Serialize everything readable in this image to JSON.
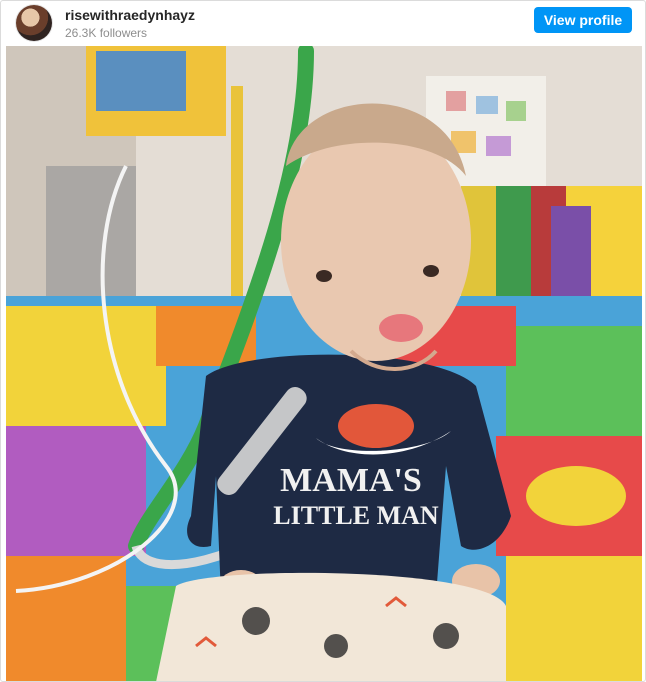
{
  "profile": {
    "username": "risewithraedynhayz",
    "followers": "26.3K followers",
    "view_profile_label": "View profile"
  },
  "post": {
    "shirt_text_line1": "MAMA'S",
    "shirt_text_line2": "LITTLE MAN"
  },
  "colors": {
    "button_blue": "#0095f6",
    "username_text": "#262626",
    "secondary_text": "#8e8e8e"
  }
}
